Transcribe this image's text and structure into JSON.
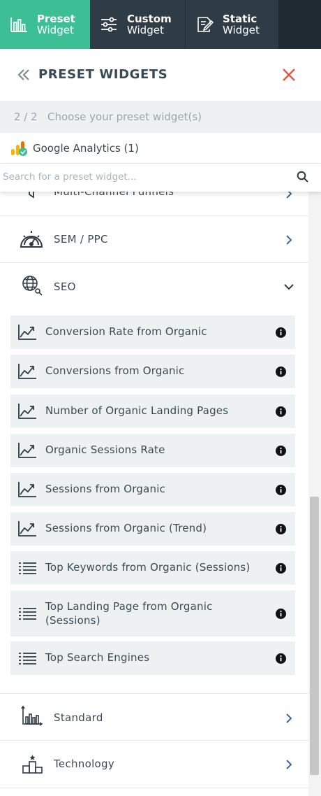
{
  "tabs": [
    {
      "bold": "Preset",
      "sub": "Widget",
      "icon": "bar-chart-icon"
    },
    {
      "bold": "Custom",
      "sub": "Widget",
      "icon": "sliders-icon"
    },
    {
      "bold": "Static",
      "sub": "Widget",
      "icon": "edit-icon"
    }
  ],
  "header": {
    "title": "PRESET WIDGETS"
  },
  "step": {
    "counter": "2 / 2",
    "description": "Choose your preset widget(s)"
  },
  "source": {
    "name": "Google Analytics (1)"
  },
  "search": {
    "placeholder": "Search for a preset widget..."
  },
  "categories": {
    "funnels": "Multi-Channel Funnels",
    "sem": "SEM / PPC",
    "seo": "SEO",
    "standard": "Standard",
    "technology": "Technology"
  },
  "seo_items": [
    {
      "label": "Conversion Rate from Organic",
      "icon": "trend-chart-icon"
    },
    {
      "label": "Conversions from Organic",
      "icon": "trend-chart-icon"
    },
    {
      "label": "Number of Organic Landing Pages",
      "icon": "trend-chart-icon"
    },
    {
      "label": "Organic Sessions Rate",
      "icon": "trend-chart-icon"
    },
    {
      "label": "Sessions from Organic",
      "icon": "trend-chart-icon"
    },
    {
      "label": "Sessions from Organic (Trend)",
      "icon": "trend-chart-icon"
    },
    {
      "label": "Top Keywords from Organic (Sessions)",
      "icon": "list-icon"
    },
    {
      "label": "Top Landing Page from Organic (Sessions)",
      "icon": "list-icon"
    },
    {
      "label": "Top Search Engines",
      "icon": "list-icon"
    }
  ],
  "colors": {
    "accent": "#3dbf95",
    "close": "#e2563f",
    "tabbar": "#2f3c46"
  }
}
